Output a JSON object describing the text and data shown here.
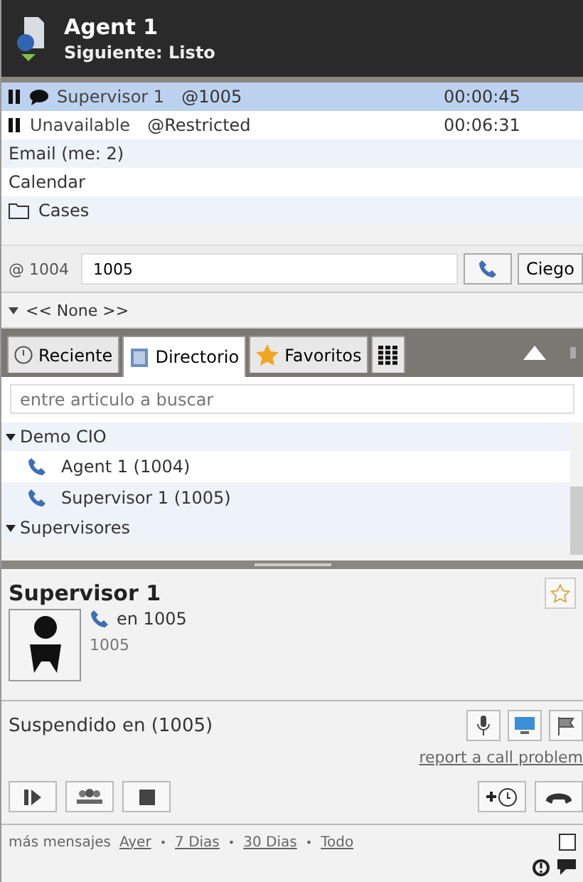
{
  "header": {
    "name": "Agent 1",
    "next_status": "Siguiente: Listo"
  },
  "sessions": [
    {
      "kind": "chat",
      "paused": true,
      "label": "Supervisor 1",
      "address": "@1005",
      "time": "00:00:45",
      "selected": true
    },
    {
      "kind": "plain",
      "paused": true,
      "label": "Unavailable",
      "address": "@Restricted",
      "time": "00:06:31",
      "selected": false
    },
    {
      "kind": "plain",
      "paused": false,
      "label": "Email (me: 2)",
      "selected": false
    },
    {
      "kind": "plain",
      "paused": false,
      "label": "Calendar",
      "selected": false
    },
    {
      "kind": "folder",
      "paused": false,
      "label": "Cases",
      "selected": false
    }
  ],
  "transfer": {
    "extension": "@ 1004",
    "value": "1005",
    "button": "Ciego"
  },
  "queue": "<< None >>",
  "tabs": [
    {
      "kind": "recent",
      "label": "Reciente",
      "selected": false
    },
    {
      "kind": "directory",
      "label": "Directorio",
      "selected": true
    },
    {
      "kind": "favorites",
      "label": "Favoritos",
      "selected": false
    },
    {
      "kind": "keypad",
      "selected": false
    }
  ],
  "search": {
    "placeholder": "entre articulo a buscar"
  },
  "tree": [
    {
      "label": "Demo CIO",
      "expanded": true,
      "children": [
        {
          "label": "Agent 1 (1004)"
        },
        {
          "label": "Supervisor 1 (1005)"
        }
      ]
    },
    {
      "label": "Supervisores",
      "expanded": true
    }
  ],
  "contact": {
    "name": "Supervisor 1",
    "status": "en 1005",
    "number": "1005",
    "favorite": false
  },
  "call": {
    "status": "Suspendido en (1005)",
    "report_link": "report a call problem"
  },
  "footer": {
    "label": "más mensajes",
    "separator": "•",
    "links": [
      "Ayer",
      "7 Dias",
      "30 Dias",
      "Todo"
    ],
    "checked": false
  }
}
